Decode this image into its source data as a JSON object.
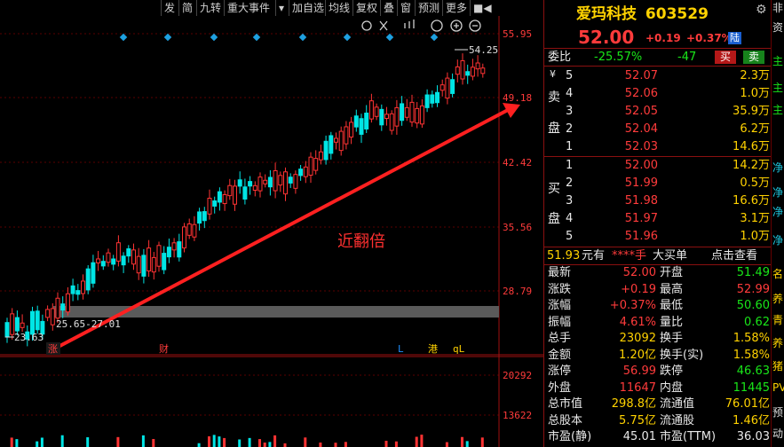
{
  "toolbar": {
    "items": [
      "发",
      "简",
      "九转",
      "重大事件",
      "▾",
      "加自选",
      "均线",
      "复权",
      "叠",
      "窗",
      "预测",
      "更多",
      "■◀"
    ]
  },
  "chart": {
    "price_axis": [
      "55.95",
      "49.18",
      "42.42",
      "35.56",
      "28.79"
    ],
    "volume_axis": [
      "20292",
      "13622"
    ],
    "high_marker": "54.25",
    "low_marker": "23.63",
    "gap_label": "25.65-27.01",
    "annotation": "近翻倍",
    "event_markers": [
      "涨",
      "财",
      "L",
      "港",
      "qL"
    ],
    "colors": {
      "up": "#ff3333",
      "down": "#00e5e5",
      "arrow": "#ff2020",
      "axis": "#ff3b3b"
    }
  },
  "quote": {
    "stock_name": "爱玛科技",
    "stock_code": "603529",
    "price": "52.00",
    "change": "+0.19",
    "change_pct": "+0.37%",
    "exchange_badge": "陆",
    "weibi_label": "委比",
    "weibi_pct": "-25.57%",
    "weicha": "-47",
    "buy_btn": "买",
    "sell_btn": "卖",
    "sell_side_chars": [
      "¥",
      "卖",
      "盘"
    ],
    "buy_side_chars": [
      "买",
      "盘"
    ],
    "asks": [
      {
        "level": "5",
        "price": "52.07",
        "vol": "2.3万"
      },
      {
        "level": "4",
        "price": "52.06",
        "vol": "1.0万"
      },
      {
        "level": "3",
        "price": "52.05",
        "vol": "35.9万"
      },
      {
        "level": "2",
        "price": "52.04",
        "vol": "6.2万"
      },
      {
        "level": "1",
        "price": "52.03",
        "vol": "14.6万"
      }
    ],
    "bids": [
      {
        "level": "1",
        "price": "52.00",
        "vol": "14.2万"
      },
      {
        "level": "2",
        "price": "51.99",
        "vol": "0.5万"
      },
      {
        "level": "3",
        "price": "51.98",
        "vol": "16.6万"
      },
      {
        "level": "4",
        "price": "51.97",
        "vol": "3.1万"
      },
      {
        "level": "5",
        "price": "51.96",
        "vol": "1.0万"
      }
    ],
    "bigbuy": {
      "price": "51.93",
      "unit": "元有",
      "masked": "****手",
      "label": "大买单",
      "link": "点击查看"
    },
    "stats": [
      {
        "l1": "最新",
        "v1": "52.00",
        "c1": "red",
        "l2": "开盘",
        "v2": "51.49",
        "c2": "green"
      },
      {
        "l1": "涨跌",
        "v1": "+0.19",
        "c1": "red",
        "l2": "最高",
        "v2": "52.99",
        "c2": "red"
      },
      {
        "l1": "涨幅",
        "v1": "+0.37%",
        "c1": "red",
        "l2": "最低",
        "v2": "50.60",
        "c2": "green"
      },
      {
        "l1": "振幅",
        "v1": "4.61%",
        "c1": "red",
        "l2": "量比",
        "v2": "0.62",
        "c2": "green"
      },
      {
        "l1": "总手",
        "v1": "23092",
        "c1": "yellow",
        "l2": "换手",
        "v2": "1.58%",
        "c2": "yellow"
      },
      {
        "l1": "金额",
        "v1": "1.20亿",
        "c1": "yellow",
        "l2": "换手(实)",
        "v2": "1.58%",
        "c2": "yellow"
      },
      {
        "l1": "涨停",
        "v1": "56.99",
        "c1": "red",
        "l2": "跌停",
        "v2": "46.63",
        "c2": "green"
      },
      {
        "l1": "外盘",
        "v1": "11647",
        "c1": "red",
        "l2": "内盘",
        "v2": "11445",
        "c2": "green"
      },
      {
        "l1": "总市值",
        "v1": "298.8亿",
        "c1": "yellow",
        "l2": "流通值",
        "v2": "76.01亿",
        "c2": "yellow"
      },
      {
        "l1": "总股本",
        "v1": "5.75亿",
        "c1": "yellow",
        "l2": "流通股",
        "v2": "1.46亿",
        "c2": "yellow"
      },
      {
        "l1": "市盈(静)",
        "v1": "45.01",
        "c1": "white",
        "l2": "市盈(TTM)",
        "v2": "36.03",
        "c2": "white"
      }
    ]
  },
  "right_strip": [
    "非",
    "资",
    "主",
    "主",
    "主",
    "净",
    "净",
    "净",
    "净",
    "名",
    "养",
    "青",
    "养",
    "猪",
    "PV",
    "预",
    "动"
  ]
}
